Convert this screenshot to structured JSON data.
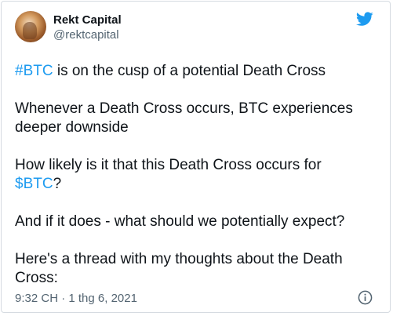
{
  "author": {
    "name": "Rekt Capital",
    "handle": "@rektcapital"
  },
  "tweet": {
    "p1_tag": "#BTC",
    "p1_rest": " is on the cusp of a potential Death Cross",
    "p2_line1": "Whenever a Death Cross occurs, BTC experiences",
    "p2_line2": "deeper downside",
    "p3_pre": "How likely is it that this Death Cross occurs for",
    "p3_tag": "$BTC",
    "p3_post": "?",
    "p4": "And if it does - what should we potentially expect?",
    "p5_line1": "Here's a thread with my thoughts about the Death",
    "p5_line2": "Cross:"
  },
  "meta": {
    "timestamp": "9:32 CH · 1 thg 6, 2021"
  },
  "icons": {
    "brand": "twitter-bird-icon",
    "info": "info-icon"
  },
  "colors": {
    "link": "#1d9bf0",
    "text": "#0f1419",
    "muted": "#536471",
    "twitter_blue": "#1d9bf0"
  }
}
